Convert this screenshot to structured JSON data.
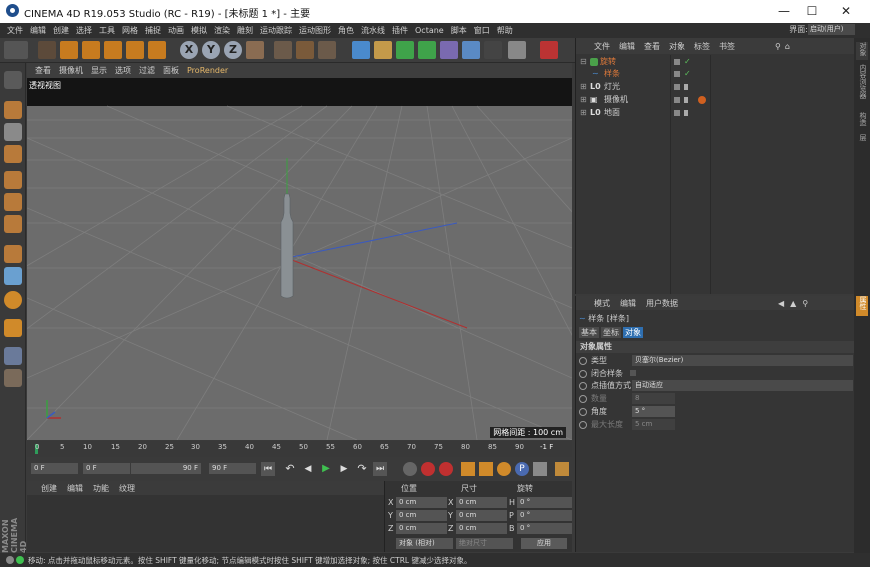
{
  "window": {
    "title": "CINEMA 4D R19.053 Studio (RC - R19) - [未标题 1 *] - 主要",
    "min_icon": "minimize-icon",
    "max_icon": "maximize-icon",
    "close_icon": "close-icon"
  },
  "menubar": {
    "items": [
      "文件",
      "编辑",
      "创建",
      "选择",
      "工具",
      "网格",
      "捕捉",
      "动画",
      "模拟",
      "渲染",
      "雕刻",
      "运动跟踪",
      "运动图形",
      "角色",
      "流水线",
      "插件",
      "Octane",
      "脚本",
      "窗口",
      "帮助"
    ],
    "layout_label": "界面:",
    "layout_value": "启动(用户)"
  },
  "viewport": {
    "menu": [
      "查看",
      "摄像机",
      "显示",
      "选项",
      "过滤",
      "面板",
      "ProRender"
    ],
    "label": "透视视图",
    "grid_spacing": "网格间距 : 100 cm"
  },
  "timeline": {
    "ticks": [
      "0",
      "5",
      "10",
      "15",
      "20",
      "25",
      "30",
      "35",
      "40",
      "45",
      "50",
      "55",
      "60",
      "65",
      "70",
      "75",
      "80",
      "85",
      "90"
    ],
    "end_frame": "-1 F",
    "start_field": "0 F",
    "min_field": "0 F",
    "max_field": "90 F",
    "end_field": "90 F"
  },
  "material": {
    "menu": [
      "创建",
      "编辑",
      "功能",
      "纹理"
    ]
  },
  "coords": {
    "headers": [
      "位置",
      "尺寸",
      "旋转"
    ],
    "rows": [
      {
        "a": "X",
        "av": "0 cm",
        "b": "X",
        "bv": "0 cm",
        "c": "H",
        "cv": "0 °"
      },
      {
        "a": "Y",
        "av": "0 cm",
        "b": "Y",
        "bv": "0 cm",
        "c": "P",
        "cv": "0 °"
      },
      {
        "a": "Z",
        "av": "0 cm",
        "b": "Z",
        "bv": "0 cm",
        "c": "B",
        "cv": "0 °"
      }
    ],
    "mode_select": "对象 (相对)",
    "size_select": "绝对尺寸",
    "apply_button": "应用"
  },
  "object_manager": {
    "menu": [
      "文件",
      "编辑",
      "查看",
      "对象",
      "标签",
      "书签"
    ],
    "objects": [
      {
        "name": "旋转",
        "indent": 0,
        "selected": true
      },
      {
        "name": "样条",
        "indent": 1,
        "selected": true
      },
      {
        "name": "灯光",
        "indent": 0,
        "selected": false
      },
      {
        "name": "摄像机",
        "indent": 0,
        "selected": false
      },
      {
        "name": "地面",
        "indent": 0,
        "selected": false
      }
    ]
  },
  "attribute_manager": {
    "menu": [
      "模式",
      "编辑",
      "用户数据"
    ],
    "object_title": "样条 [样条]",
    "tabs": [
      "基本",
      "坐标",
      "对象"
    ],
    "section": "对象属性",
    "fields": [
      {
        "label": "类型",
        "value": "贝塞尔(Bezier)"
      },
      {
        "label": "闭合样条",
        "value": ""
      },
      {
        "label": "点插值方式",
        "value": "自动适应"
      },
      {
        "label": "数量",
        "value": "8"
      },
      {
        "label": "角度",
        "value": "5 °"
      },
      {
        "label": "最大长度",
        "value": "5 cm"
      }
    ]
  },
  "right_tabs": [
    "对象",
    "内容浏览器",
    "构造",
    "层",
    "属性"
  ],
  "status": {
    "text": "移动: 点击并拖动鼠标移动元素。按住 SHIFT 键量化移动; 节点编辑模式时按住 SHIFT 键增加选择对象; 按住 CTRL 键减少选择对象。"
  },
  "maxon_brand": "MAXON CINEMA 4D"
}
